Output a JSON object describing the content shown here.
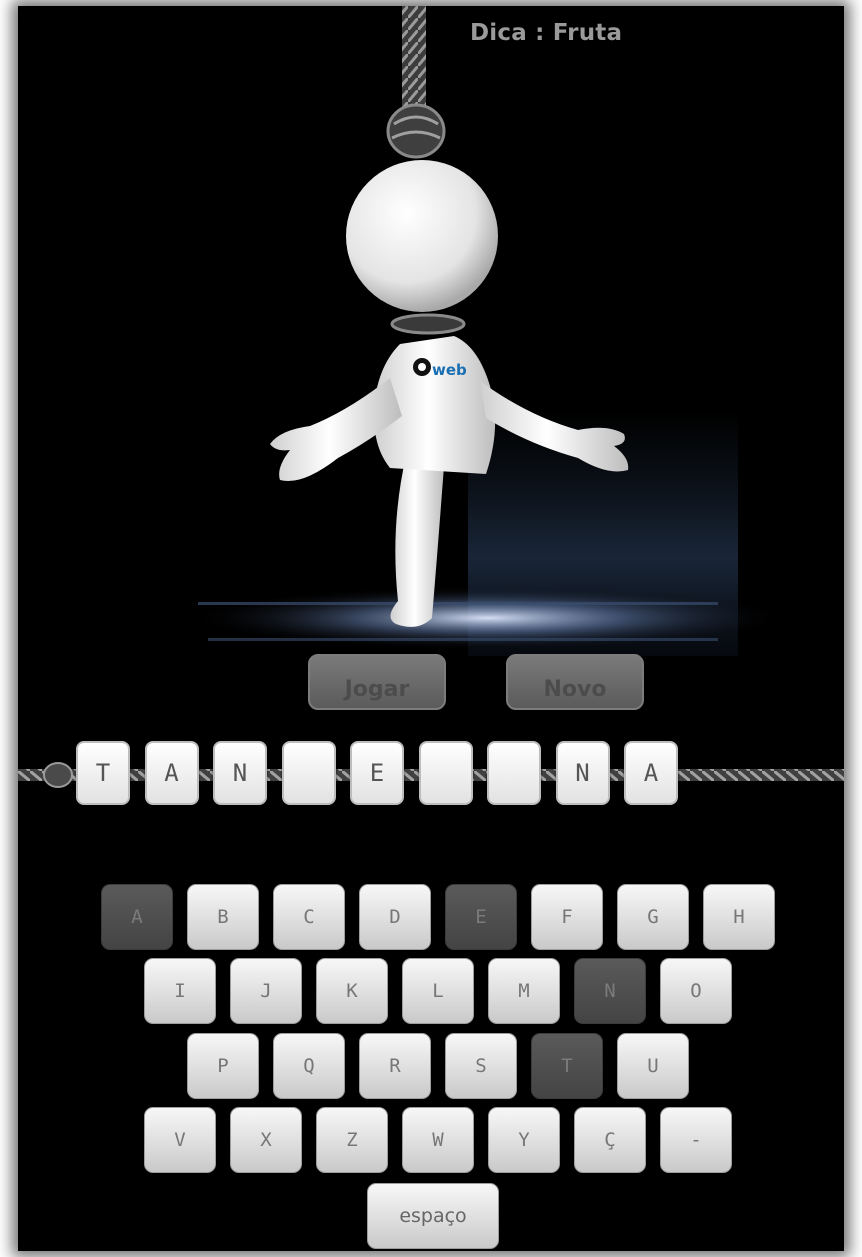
{
  "game": {
    "hint": "Dica : Fruta",
    "logo_text": "Qweb",
    "buttons": {
      "play": "Jogar",
      "new": "Novo"
    },
    "word_tiles": [
      "T",
      "A",
      "N",
      "",
      "E",
      "",
      "",
      "N",
      "A"
    ],
    "keyboard": {
      "rows": [
        [
          "A",
          "B",
          "C",
          "D",
          "E",
          "F",
          "G",
          "H"
        ],
        [
          "I",
          "J",
          "K",
          "L",
          "M",
          "N",
          "O"
        ],
        [
          "P",
          "Q",
          "R",
          "S",
          "T",
          "U"
        ],
        [
          "V",
          "X",
          "Z",
          "W",
          "Y",
          "Ç",
          "-"
        ]
      ],
      "used": [
        "A",
        "E",
        "N",
        "T"
      ],
      "space": "espaço"
    }
  },
  "colors": {
    "background": "#000000",
    "key_face": "#e6e6e6",
    "key_used": "#505050",
    "hint_text": "#9a9a9a",
    "logo_blue": "#1a6fb3"
  }
}
